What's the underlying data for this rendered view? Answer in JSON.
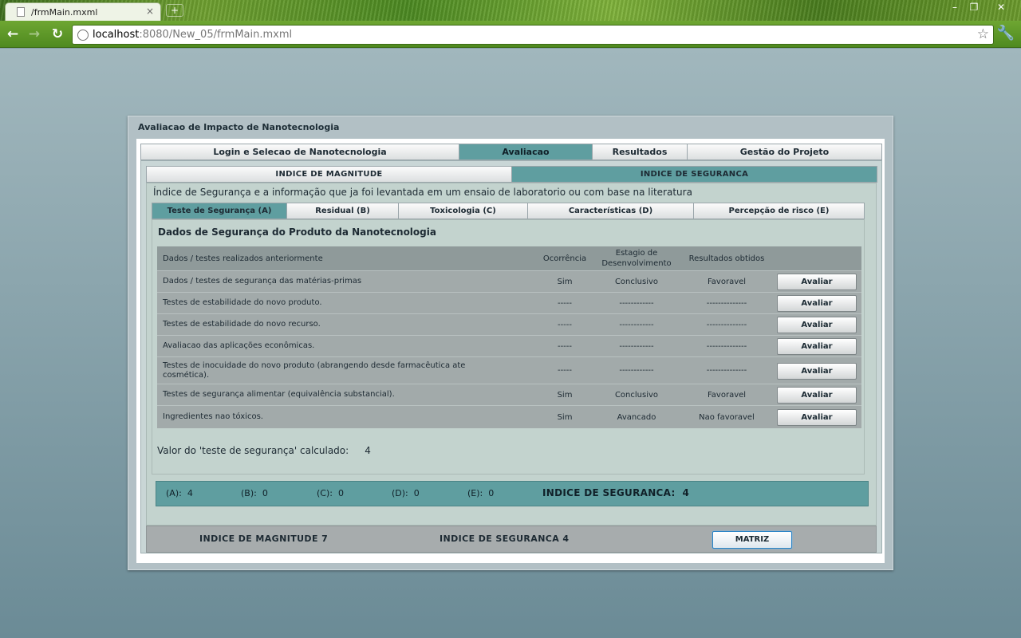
{
  "browser": {
    "tab_title": "/frmMain.mxml",
    "url_host": "localhost",
    "url_rest": ":8080/New_05/frmMain.mxml"
  },
  "app": {
    "title": "Avaliacao de Impacto de Nanotecnologia",
    "main_tabs": [
      "Login e Selecao de Nanotecnologia",
      "Avaliacao",
      "Resultados",
      "Gestão do Projeto"
    ],
    "sub_tabs": [
      "INDICE DE MAGNITUDE",
      "INDICE DE SEGURANCA"
    ],
    "description": "Índice de Segurança e a informação que ja foi levantada em um ensaio de laboratorio ou com base na literatura",
    "category_tabs": [
      "Teste de Segurança (A)",
      "Residual (B)",
      "Toxicologia (C)",
      "Características (D)",
      "Percepção de risco (E)"
    ],
    "section_title": "Dados de Segurança do Produto da Nanotecnologia",
    "grid": {
      "headers": {
        "desc": "Dados / testes realizados anteriormente",
        "ocorrencia": "Ocorrência",
        "estagio": "Estagio de Desenvolvimento",
        "resultados": "Resultados obtidos"
      },
      "rows": [
        {
          "desc": "Dados / testes de segurança das matérias-primas",
          "oc": "Sim",
          "est": "Conclusivo",
          "res": "Favoravel",
          "btn": "Avaliar"
        },
        {
          "desc": "Testes de estabilidade do novo produto.",
          "oc": "-----",
          "est": "------------",
          "res": "--------------",
          "btn": "Avaliar"
        },
        {
          "desc": "Testes de estabilidade do novo recurso.",
          "oc": "-----",
          "est": "------------",
          "res": "--------------",
          "btn": "Avaliar"
        },
        {
          "desc": "Avaliacao das aplicações econômicas.",
          "oc": "-----",
          "est": "------------",
          "res": "--------------",
          "btn": "Avaliar"
        },
        {
          "desc": "Testes de inocuidade do novo produto (abrangendo desde farmacêutica ate cosmética).",
          "oc": "-----",
          "est": "------------",
          "res": "--------------",
          "btn": "Avaliar"
        },
        {
          "desc": "Testes de segurança alimentar (equivalência substancial).",
          "oc": "Sim",
          "est": "Conclusivo",
          "res": "Favoravel",
          "btn": "Avaliar"
        },
        {
          "desc": "Ingredientes nao tóxicos.",
          "oc": "Sim",
          "est": "Avancado",
          "res": "Nao favoravel",
          "btn": "Avaliar"
        }
      ]
    },
    "calc_label": "Valor do 'teste de segurança' calculado:",
    "calc_value": "4",
    "summary": {
      "a_label": "(A):",
      "a_value": "4",
      "b_label": "(B):",
      "b_value": "0",
      "c_label": "(C):",
      "c_value": "0",
      "d_label": "(D):",
      "d_value": "0",
      "e_label": "(E):",
      "e_value": "0",
      "total_label": "INDICE DE SEGURANCA:",
      "total_value": "4"
    },
    "footer": {
      "magnitude": "INDICE DE MAGNITUDE 7",
      "seguranca": "INDICE DE SEGURANCA 4",
      "matriz_btn": "MATRIZ"
    }
  },
  "colors": {
    "accent_teal": "#5f9ea0",
    "panel_green": "#c3d3ce",
    "browser_green": "#5f9a2a"
  },
  "icons": [
    "page-icon",
    "close-icon",
    "new-tab-icon",
    "minimize-icon",
    "restore-icon",
    "window-close-icon",
    "back-icon",
    "forward-icon",
    "reload-icon",
    "globe-icon",
    "star-icon",
    "wrench-icon"
  ]
}
